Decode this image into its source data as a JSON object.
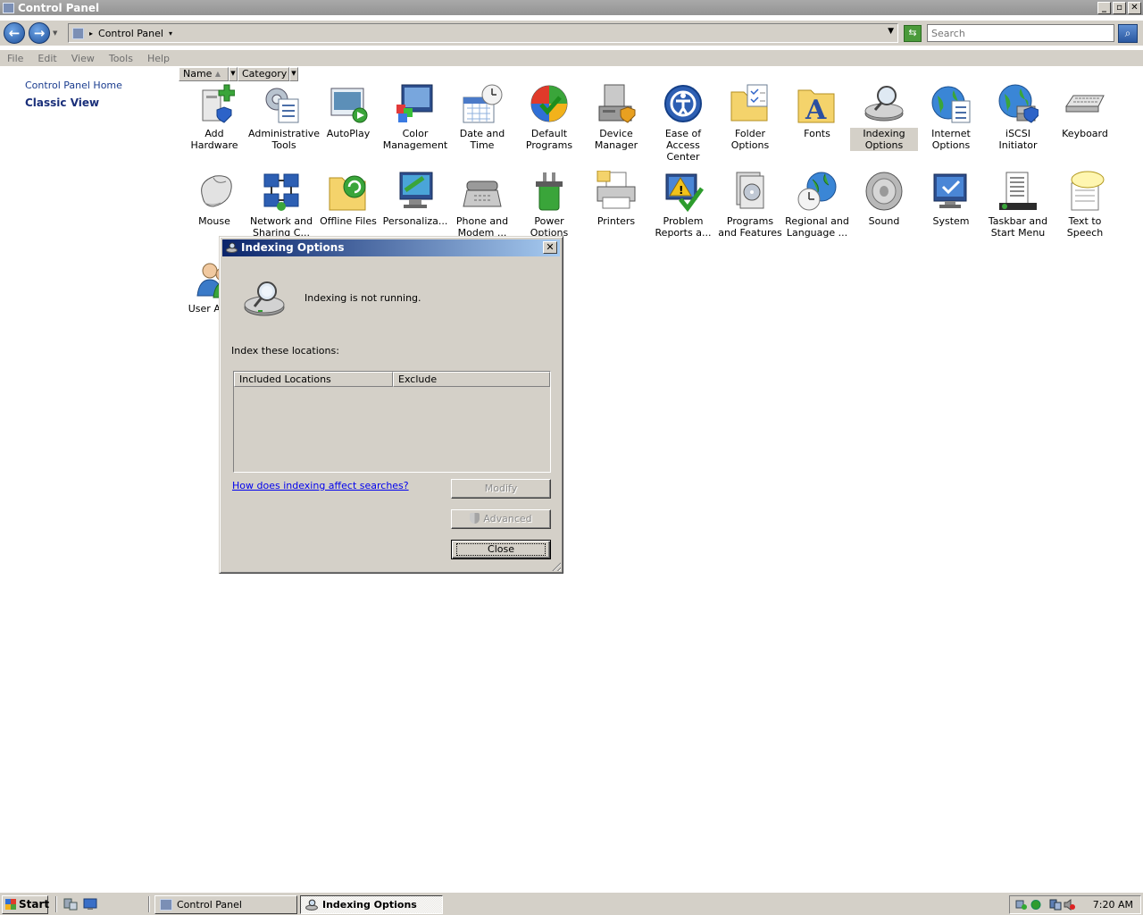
{
  "window": {
    "title": "Control Panel"
  },
  "address_bar": {
    "location": "Control Panel",
    "search_placeholder": "Search"
  },
  "menu": [
    "File",
    "Edit",
    "View",
    "Tools",
    "Help"
  ],
  "left_pane": {
    "home_link": "Control Panel Home",
    "classic_view": "Classic View"
  },
  "columns": [
    "Name",
    "Category"
  ],
  "icons": [
    {
      "label": "Add Hardware",
      "icon": "add-hardware-icon"
    },
    {
      "label": "Administrative Tools",
      "icon": "administrative-tools-icon"
    },
    {
      "label": "AutoPlay",
      "icon": "autoplay-icon"
    },
    {
      "label": "Color Management",
      "icon": "color-management-icon"
    },
    {
      "label": "Date and Time",
      "icon": "date-and-time-icon"
    },
    {
      "label": "Default Programs",
      "icon": "default-programs-icon"
    },
    {
      "label": "Device Manager",
      "icon": "device-manager-icon"
    },
    {
      "label": "Ease of Access Center",
      "icon": "ease-of-access-icon"
    },
    {
      "label": "Folder Options",
      "icon": "folder-options-icon"
    },
    {
      "label": "Fonts",
      "icon": "fonts-icon"
    },
    {
      "label": "Indexing Options",
      "icon": "indexing-options-icon"
    },
    {
      "label": "Internet Options",
      "icon": "internet-options-icon"
    },
    {
      "label": "iSCSI Initiator",
      "icon": "iscsi-initiator-icon"
    },
    {
      "label": "Keyboard",
      "icon": "keyboard-icon"
    },
    {
      "label": "Mouse",
      "icon": "mouse-icon"
    },
    {
      "label": "Network and Sharing C...",
      "icon": "network-sharing-icon"
    },
    {
      "label": "Offline Files",
      "icon": "offline-files-icon"
    },
    {
      "label": "Personaliza...",
      "icon": "personalization-icon"
    },
    {
      "label": "Phone and Modem ...",
      "icon": "phone-modem-icon"
    },
    {
      "label": "Power Options",
      "icon": "power-options-icon"
    },
    {
      "label": "Printers",
      "icon": "printers-icon"
    },
    {
      "label": "Problem Reports a...",
      "icon": "problem-reports-icon"
    },
    {
      "label": "Programs and Features",
      "icon": "programs-features-icon"
    },
    {
      "label": "Regional and Language ...",
      "icon": "regional-language-icon"
    },
    {
      "label": "Sound",
      "icon": "sound-icon"
    },
    {
      "label": "System",
      "icon": "system-icon"
    },
    {
      "label": "Taskbar and Start Menu",
      "icon": "taskbar-start-menu-icon"
    },
    {
      "label": "Text to Speech",
      "icon": "text-to-speech-icon"
    },
    {
      "label": "User Acc...",
      "icon": "user-accounts-icon"
    }
  ],
  "dialog": {
    "title": "Indexing Options",
    "status": "Indexing is not running.",
    "locations_label": "Index these locations:",
    "columns": [
      "Included Locations",
      "Exclude"
    ],
    "help_link": "How does indexing affect searches?",
    "modify": "Modify",
    "advanced": "Advanced",
    "close": "Close"
  },
  "taskbar": {
    "start": "Start",
    "tasks": [
      "Control Panel",
      "Indexing Options"
    ],
    "clock": "7:20 AM"
  }
}
